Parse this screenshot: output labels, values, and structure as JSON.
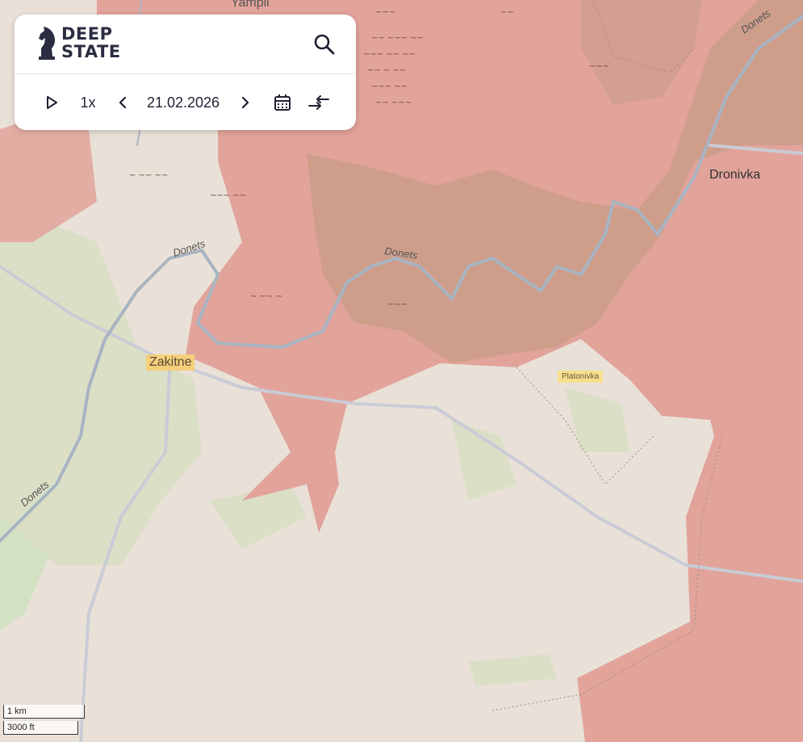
{
  "app": {
    "brand_line1": "DEEP",
    "brand_line2": "STATE"
  },
  "icons": {
    "logo": "knight-chess-logo-icon",
    "search": "search-icon",
    "play": "play-icon",
    "prev": "chevron-left-icon",
    "next": "chevron-right-icon",
    "calendar": "calendar-icon",
    "compare": "compare-arrows-icon"
  },
  "timeline": {
    "speed": "1x",
    "date": "21.02.2026"
  },
  "map": {
    "places": {
      "yampil": "Yampil",
      "dronivka": "Dronivka",
      "zakitne": "Zakitne",
      "platonivka": "Platonivka"
    },
    "rivers": {
      "donets_top": "Donets",
      "donets_west": "Donets",
      "donets_mid": "Donets",
      "donets_sw": "Donets"
    },
    "scale": {
      "metric": "1 km",
      "imperial": "3000 ft"
    },
    "colors": {
      "occupied": "#e2a29a",
      "contested": "#c59a84",
      "base": "#e8dfd6",
      "forest": "#dfe3cc",
      "river": "#a9b6c4"
    }
  }
}
